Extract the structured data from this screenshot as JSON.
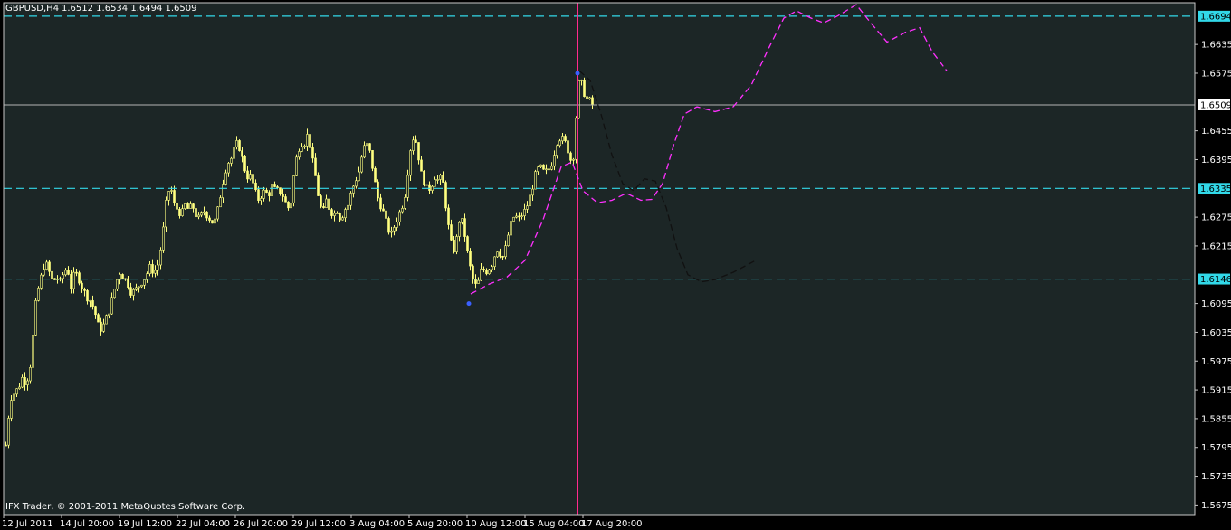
{
  "chart_data": {
    "type": "candlestick",
    "symbol": "GBPUSD,H4",
    "ohlc": "1.6512 1.6534 1.6494 1.6509",
    "copyright": "IFX Trader, © 2001-2011 MetaQuotes Software Corp.",
    "ylim": [
      1.5655,
      1.6722
    ],
    "y_ticks": [
      "1.6635",
      "1.6575",
      "1.6455",
      "1.6395",
      "1.6275",
      "1.6215",
      "1.6095",
      "1.6035",
      "1.5975",
      "1.5915",
      "1.5855",
      "1.5795",
      "1.5735",
      "1.5675"
    ],
    "x_ticks": [
      "12 Jul 2011",
      "14 Jul 20:00",
      "19 Jul 12:00",
      "22 Jul 04:00",
      "26 Jul 20:00",
      "29 Jul 12:00",
      "3 Aug 04:00",
      "5 Aug 20:00",
      "10 Aug 12:00",
      "15 Aug 04:00",
      "17 Aug 20:00"
    ],
    "current_price": "1.6509",
    "levels": [
      {
        "value": 1.6694,
        "label": "1.6694"
      },
      {
        "value": 1.6335,
        "label": "1.6335"
      },
      {
        "value": 1.6146,
        "label": "1.6146"
      }
    ],
    "close_path": [
      [
        0,
        1.59
      ],
      [
        3,
        1.584
      ],
      [
        6,
        1.58
      ],
      [
        9,
        1.586
      ],
      [
        12,
        1.59
      ],
      [
        16,
        1.591
      ],
      [
        20,
        1.592
      ],
      [
        24,
        1.594
      ],
      [
        28,
        1.593
      ],
      [
        32,
        1.595
      ],
      [
        35,
        1.6
      ],
      [
        38,
        1.608
      ],
      [
        41,
        1.612
      ],
      [
        44,
        1.614
      ],
      [
        47,
        1.617
      ],
      [
        50,
        1.618
      ],
      [
        54,
        1.616
      ],
      [
        58,
        1.614
      ],
      [
        62,
        1.615
      ],
      [
        66,
        1.614
      ],
      [
        70,
        1.616
      ],
      [
        74,
        1.617
      ],
      [
        78,
        1.613
      ],
      [
        82,
        1.616
      ],
      [
        86,
        1.615
      ],
      [
        90,
        1.613
      ],
      [
        95,
        1.611
      ],
      [
        100,
        1.61
      ],
      [
        104,
        1.608
      ],
      [
        108,
        1.605
      ],
      [
        112,
        1.604
      ],
      [
        116,
        1.606
      ],
      [
        120,
        1.608
      ],
      [
        124,
        1.611
      ],
      [
        128,
        1.614
      ],
      [
        132,
        1.616
      ],
      [
        136,
        1.615
      ],
      [
        140,
        1.614
      ],
      [
        144,
        1.612
      ],
      [
        148,
        1.612
      ],
      [
        152,
        1.613
      ],
      [
        156,
        1.614
      ],
      [
        160,
        1.615
      ],
      [
        165,
        1.617
      ],
      [
        170,
        1.616
      ],
      [
        175,
        1.618
      ],
      [
        180,
        1.625
      ],
      [
        184,
        1.632
      ],
      [
        188,
        1.634
      ],
      [
        192,
        1.63
      ],
      [
        196,
        1.629
      ],
      [
        200,
        1.628
      ],
      [
        204,
        1.63
      ],
      [
        208,
        1.629
      ],
      [
        212,
        1.63
      ],
      [
        216,
        1.628
      ],
      [
        220,
        1.627
      ],
      [
        224,
        1.629
      ],
      [
        228,
        1.628
      ],
      [
        232,
        1.627
      ],
      [
        236,
        1.626
      ],
      [
        240,
        1.629
      ],
      [
        244,
        1.633
      ],
      [
        248,
        1.637
      ],
      [
        252,
        1.639
      ],
      [
        256,
        1.64
      ],
      [
        260,
        1.643
      ],
      [
        264,
        1.642
      ],
      [
        268,
        1.639
      ],
      [
        272,
        1.636
      ],
      [
        276,
        1.636
      ],
      [
        280,
        1.634
      ],
      [
        284,
        1.631
      ],
      [
        288,
        1.632
      ],
      [
        292,
        1.633
      ],
      [
        296,
        1.632
      ],
      [
        300,
        1.634
      ],
      [
        304,
        1.633
      ],
      [
        308,
        1.633
      ],
      [
        312,
        1.632
      ],
      [
        316,
        1.63
      ],
      [
        320,
        1.629
      ],
      [
        324,
        1.636
      ],
      [
        328,
        1.641
      ],
      [
        332,
        1.643
      ],
      [
        336,
        1.643
      ],
      [
        340,
        1.645
      ],
      [
        344,
        1.64
      ],
      [
        348,
        1.636
      ],
      [
        352,
        1.631
      ],
      [
        356,
        1.628
      ],
      [
        360,
        1.631
      ],
      [
        364,
        1.629
      ],
      [
        368,
        1.628
      ],
      [
        372,
        1.629
      ],
      [
        376,
        1.627
      ],
      [
        380,
        1.629
      ],
      [
        384,
        1.63
      ],
      [
        388,
        1.633
      ],
      [
        392,
        1.635
      ],
      [
        396,
        1.637
      ],
      [
        400,
        1.641
      ],
      [
        404,
        1.643
      ],
      [
        408,
        1.641
      ],
      [
        412,
        1.637
      ],
      [
        416,
        1.632
      ],
      [
        420,
        1.63
      ],
      [
        424,
        1.628
      ],
      [
        428,
        1.625
      ],
      [
        432,
        1.624
      ],
      [
        436,
        1.626
      ],
      [
        440,
        1.628
      ],
      [
        444,
        1.63
      ],
      [
        448,
        1.633
      ],
      [
        452,
        1.641
      ],
      [
        456,
        1.644
      ],
      [
        460,
        1.643
      ],
      [
        464,
        1.637
      ],
      [
        468,
        1.635
      ],
      [
        472,
        1.633
      ],
      [
        476,
        1.634
      ],
      [
        480,
        1.636
      ],
      [
        484,
        1.635
      ],
      [
        488,
        1.636
      ],
      [
        492,
        1.63
      ],
      [
        496,
        1.624
      ],
      [
        500,
        1.62
      ],
      [
        504,
        1.623
      ],
      [
        508,
        1.628
      ],
      [
        512,
        1.625
      ],
      [
        516,
        1.62
      ],
      [
        520,
        1.616
      ],
      [
        524,
        1.613
      ],
      [
        528,
        1.614
      ],
      [
        532,
        1.617
      ],
      [
        536,
        1.616
      ],
      [
        540,
        1.617
      ],
      [
        544,
        1.618
      ],
      [
        548,
        1.621
      ],
      [
        552,
        1.62
      ],
      [
        556,
        1.619
      ],
      [
        560,
        1.623
      ],
      [
        564,
        1.626
      ],
      [
        568,
        1.628
      ],
      [
        572,
        1.627
      ],
      [
        576,
        1.628
      ],
      [
        580,
        1.629
      ],
      [
        584,
        1.631
      ],
      [
        588,
        1.634
      ],
      [
        592,
        1.637
      ],
      [
        596,
        1.638
      ],
      [
        600,
        1.637
      ],
      [
        604,
        1.637
      ],
      [
        608,
        1.638
      ],
      [
        612,
        1.641
      ],
      [
        616,
        1.644
      ],
      [
        620,
        1.644
      ],
      [
        624,
        1.643
      ],
      [
        628,
        1.641
      ],
      [
        632,
        1.638
      ],
      [
        635,
        1.645
      ],
      [
        638,
        1.655
      ],
      [
        641,
        1.656
      ],
      [
        644,
        1.654
      ],
      [
        647,
        1.652
      ],
      [
        650,
        1.652
      ],
      [
        654,
        1.651
      ],
      [
        656,
        1.651
      ]
    ],
    "series": [
      {
        "style": "dashed",
        "color": "#ff30ff",
        "points": [
          [
            520,
            1.6115
          ],
          [
            540,
            1.6135
          ],
          [
            560,
            1.615
          ],
          [
            580,
            1.6185
          ],
          [
            600,
            1.627
          ],
          [
            620,
            1.638
          ],
          [
            632,
            1.639
          ],
          [
            644,
            1.633
          ],
          [
            660,
            1.6305
          ],
          [
            676,
            1.631
          ],
          [
            692,
            1.6325
          ],
          [
            708,
            1.631
          ],
          [
            720,
            1.6312
          ],
          [
            732,
            1.6345
          ],
          [
            745,
            1.643
          ],
          [
            756,
            1.649
          ],
          [
            770,
            1.6505
          ],
          [
            790,
            1.6495
          ],
          [
            810,
            1.6505
          ],
          [
            830,
            1.655
          ],
          [
            850,
            1.663
          ],
          [
            866,
            1.669
          ],
          [
            880,
            1.6705
          ],
          [
            896,
            1.669
          ],
          [
            910,
            1.668
          ],
          [
            926,
            1.6695
          ],
          [
            946,
            1.6718
          ],
          [
            962,
            1.668
          ],
          [
            980,
            1.664
          ],
          [
            1000,
            1.666
          ],
          [
            1016,
            1.667
          ],
          [
            1030,
            1.662
          ],
          [
            1046,
            1.658
          ]
        ]
      },
      {
        "style": "dashed",
        "color": "#111111",
        "points": [
          [
            640,
            1.658
          ],
          [
            652,
            1.656
          ],
          [
            664,
            1.649
          ],
          [
            676,
            1.6405
          ],
          [
            688,
            1.6345
          ],
          [
            700,
            1.633
          ],
          [
            712,
            1.6355
          ],
          [
            724,
            1.635
          ],
          [
            736,
            1.6295
          ],
          [
            748,
            1.621
          ],
          [
            760,
            1.6155
          ],
          [
            775,
            1.614
          ],
          [
            790,
            1.6145
          ],
          [
            810,
            1.616
          ],
          [
            835,
            1.6185
          ]
        ]
      }
    ],
    "markers": [
      {
        "x": 638,
        "y": 1.6575,
        "color": "#3a60ff"
      },
      {
        "x": 518,
        "y": 1.6095,
        "color": "#3a60ff"
      }
    ],
    "vline_x": 638,
    "colors": {
      "bg": "#1c2626",
      "candle": "#ffff80",
      "level": "#32d8e8",
      "vline": "#ff2a8c",
      "axis_text": "#ffffff",
      "frame": "#c8c8c8",
      "label_box": "#32d8e8"
    }
  }
}
